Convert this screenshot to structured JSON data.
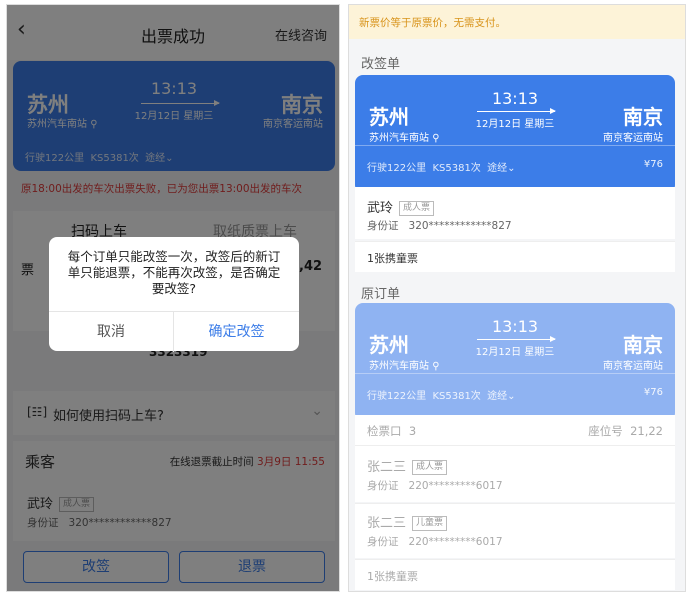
{
  "left": {
    "back_icon": "chevron-left-icon",
    "title": "出票成功",
    "consult": "在线咨询",
    "ticket": {
      "from_city": "苏州",
      "from_station": "苏州汽车南站",
      "time": "13:13",
      "date": "12月12日 星期三",
      "to_city": "南京",
      "to_station": "南京客运南站",
      "distance": "行驶122公里",
      "train": "KS5381次",
      "via": "途经"
    },
    "notice": "原18:00出发的车次出票失败，已为您出票13:00出发的车次",
    "tabs": [
      "扫码上车",
      "取纸质票上车"
    ],
    "side_left": "票",
    "side_right": "42",
    "code": "3323319",
    "how_label": "如何使用扫码上车?",
    "passenger_label": "乘客",
    "deadline_label": "在线退票截止时间",
    "deadline_value": "3月9日 11:55",
    "passenger": {
      "name": "武玲",
      "type": "成人票",
      "id_label": "身份证",
      "id_value": "320************827"
    },
    "change_btn": "改签",
    "refund_btn": "退票",
    "dialog": {
      "message": "每个订单只能改签一次，改签后的新订单只能退票，不能再次改签，是否确定要改签?",
      "cancel": "取消",
      "confirm": "确定改签"
    }
  },
  "right": {
    "banner": "新票价等于原票价，无需支付。",
    "change_section": "改签单",
    "new_ticket": {
      "from_city": "苏州",
      "from_station": "苏州汽车南站",
      "time": "13:13",
      "date": "12月12日 星期三",
      "to_city": "南京",
      "to_station": "南京客运南站",
      "distance": "行驶122公里",
      "train": "KS5381次",
      "via": "途经",
      "price": "¥76"
    },
    "new_passenger": {
      "name": "武玲",
      "type": "成人票",
      "id_label": "身份证",
      "id_value": "320************827"
    },
    "child_ticket": "1张携童票",
    "orig_section": "原订单",
    "orig_ticket": {
      "from_city": "苏州",
      "from_station": "苏州汽车南站",
      "time": "13:13",
      "date": "12月12日 星期三",
      "to_city": "南京",
      "to_station": "南京客运南站",
      "distance": "行驶122公里",
      "train": "KS5381次",
      "via": "途经",
      "price": "¥76"
    },
    "gate_label": "检票口",
    "gate_value": "3",
    "seat_label": "座位号",
    "seat_value": "21,22",
    "orig_passengers": [
      {
        "name": "张二三",
        "type": "成人票",
        "id_label": "身份证",
        "id_value": "220*********6017"
      },
      {
        "name": "张二三",
        "type": "儿童票",
        "id_label": "身份证",
        "id_value": "220*********6017"
      }
    ],
    "orig_child": "1张携童票"
  },
  "colors": {
    "primary": "#3c7de8",
    "primary_light": "#8fb3f2",
    "alert": "#e03a3a",
    "banner_bg": "#fdf3d8",
    "banner_text": "#d8931a"
  }
}
